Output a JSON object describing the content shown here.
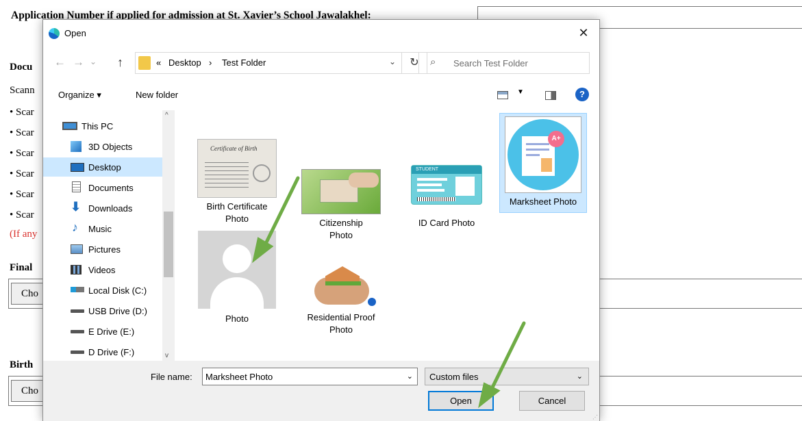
{
  "background": {
    "application_label": "Application Number if applied for admission at St. Xavier’s School Jawalakhel:",
    "documents_title": "Docu",
    "scan_intro": "Scann",
    "bullets": [
      "• Scar",
      "• Scar",
      "• Scar",
      "• Scar",
      "• Scar",
      "• Scar"
    ],
    "note": "(If any",
    "final_label": "Final",
    "choose_label": "Cho",
    "birth_label": "Birth",
    "choose_label_2": "Cho"
  },
  "dialog": {
    "title": "Open",
    "close_glyph": "✕",
    "nav": {
      "back": "←",
      "forward": "→",
      "recent": "⌄",
      "up": "↑",
      "crumb_prefix": "«",
      "crumbs": [
        "Desktop",
        "Test Folder"
      ],
      "separator": "›",
      "dropdown": "⌄",
      "refresh": "↻",
      "search_placeholder": "Search Test Folder"
    },
    "toolbar": {
      "organize": "Organize ▾",
      "new_folder": "New folder",
      "view_chevron": "▼",
      "help": "?"
    },
    "sidebar": [
      {
        "label": "This PC",
        "icon": "monitor-icon"
      },
      {
        "label": "3D Objects",
        "icon": "cube-icon"
      },
      {
        "label": "Desktop",
        "icon": "desktop-icon",
        "selected": true
      },
      {
        "label": "Documents",
        "icon": "document-icon"
      },
      {
        "label": "Downloads",
        "icon": "download-arrow-icon"
      },
      {
        "label": "Music",
        "icon": "music-note-icon"
      },
      {
        "label": "Pictures",
        "icon": "picture-icon"
      },
      {
        "label": "Videos",
        "icon": "film-icon"
      },
      {
        "label": "Local Disk (C:)",
        "icon": "windows-drive-icon"
      },
      {
        "label": "USB Drive (D:)",
        "icon": "drive-icon"
      },
      {
        "label": "E Drive (E:)",
        "icon": "drive-icon"
      },
      {
        "label": "D Drive (F:)",
        "icon": "drive-icon"
      }
    ],
    "scroll": {
      "up": "^",
      "down": "v"
    },
    "files": [
      {
        "name_1": "Birth Certificate",
        "name_2": "Photo",
        "thumb_text": "Certificate of Birth"
      },
      {
        "name_1": "Citizenship",
        "name_2": "Photo"
      },
      {
        "name_1": "ID Card Photo",
        "name_2": "",
        "thumb_text": "STUDENT"
      },
      {
        "name_1": "Marksheet Photo",
        "name_2": "",
        "selected": true,
        "badge": "A+"
      },
      {
        "name_1": "Photo",
        "name_2": ""
      },
      {
        "name_1": "Residential Proof",
        "name_2": "Photo"
      }
    ],
    "bottom": {
      "file_name_label": "File name:",
      "file_name_value": "Marksheet Photo",
      "file_type_value": "Custom files",
      "open_label": "Open",
      "cancel_label": "Cancel"
    }
  },
  "colors": {
    "accent": "#0078d7",
    "selection": "#cce8ff",
    "arrow": "#6fac46",
    "note_red": "#d9302c"
  }
}
